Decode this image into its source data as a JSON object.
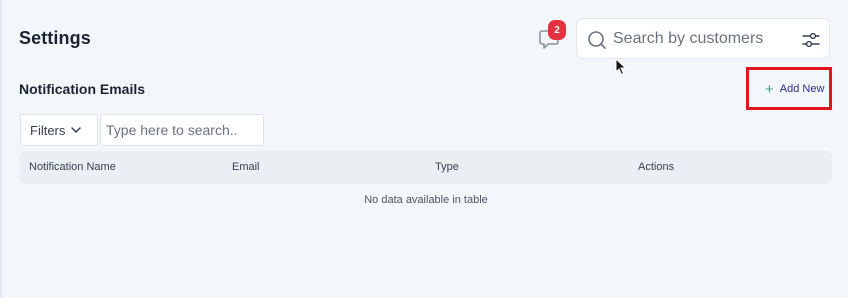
{
  "header": {
    "title": "Settings",
    "notifications": {
      "icon": "chat-bubble-icon",
      "badge_count": "2"
    },
    "search": {
      "placeholder": "Search by customers",
      "value": "",
      "icon": "search-icon",
      "filter_icon": "sliders-icon"
    }
  },
  "section": {
    "title": "Notification Emails",
    "add_new_label": "Add New",
    "add_new_icon": "plus-icon"
  },
  "toolbar": {
    "filters_label": "Filters",
    "filters_icon": "chevron-down-icon",
    "search_placeholder": "Type here to search.."
  },
  "table": {
    "columns": [
      "Notification Name",
      "Email",
      "Type",
      "Actions"
    ],
    "rows": [],
    "empty_message": "No data available in table"
  },
  "colors": {
    "background": "#f3f6fa",
    "badge": "#e5323e",
    "add_new_text": "#2c2f8c",
    "highlight": "#e0141e"
  }
}
